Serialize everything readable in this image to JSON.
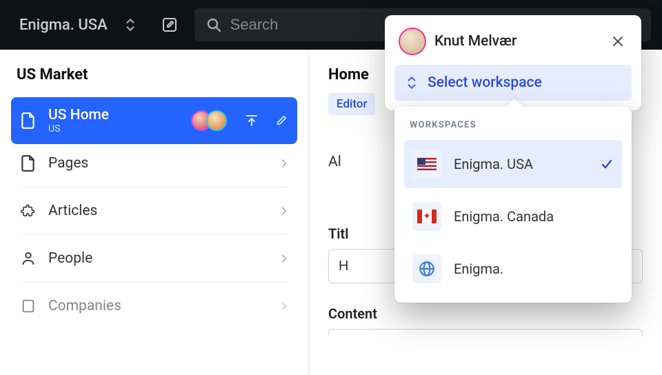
{
  "topbar": {
    "workspace_label": "Enigma. USA",
    "search_placeholder": "Search"
  },
  "sidebar": {
    "title": "US Market",
    "items": [
      {
        "label": "US Home",
        "sub": "US",
        "icon": "file-icon",
        "active": true
      },
      {
        "label": "Pages",
        "icon": "file-icon"
      },
      {
        "label": "Articles",
        "icon": "puzzle-icon"
      },
      {
        "label": "People",
        "icon": "person-icon"
      },
      {
        "label": "Companies",
        "icon": "building-icon"
      }
    ]
  },
  "content": {
    "title": "Home",
    "tag": "Editor",
    "row_label": "Al",
    "field1_label": "Titl",
    "field1_value": "H",
    "field2_label": "Content"
  },
  "popover": {
    "user_name": "Knut Melvær",
    "select_label": "Select workspace",
    "section_title": "WORKSPACES",
    "items": [
      {
        "label": "Enigma. USA",
        "flag": "us",
        "selected": true
      },
      {
        "label": "Enigma. Canada",
        "flag": "ca",
        "selected": false
      },
      {
        "label": "Enigma.",
        "flag": "globe",
        "selected": false
      }
    ]
  },
  "colors": {
    "accent": "#2563ff",
    "accent_light": "#e6edff",
    "accent_text": "#2b4cd9"
  }
}
